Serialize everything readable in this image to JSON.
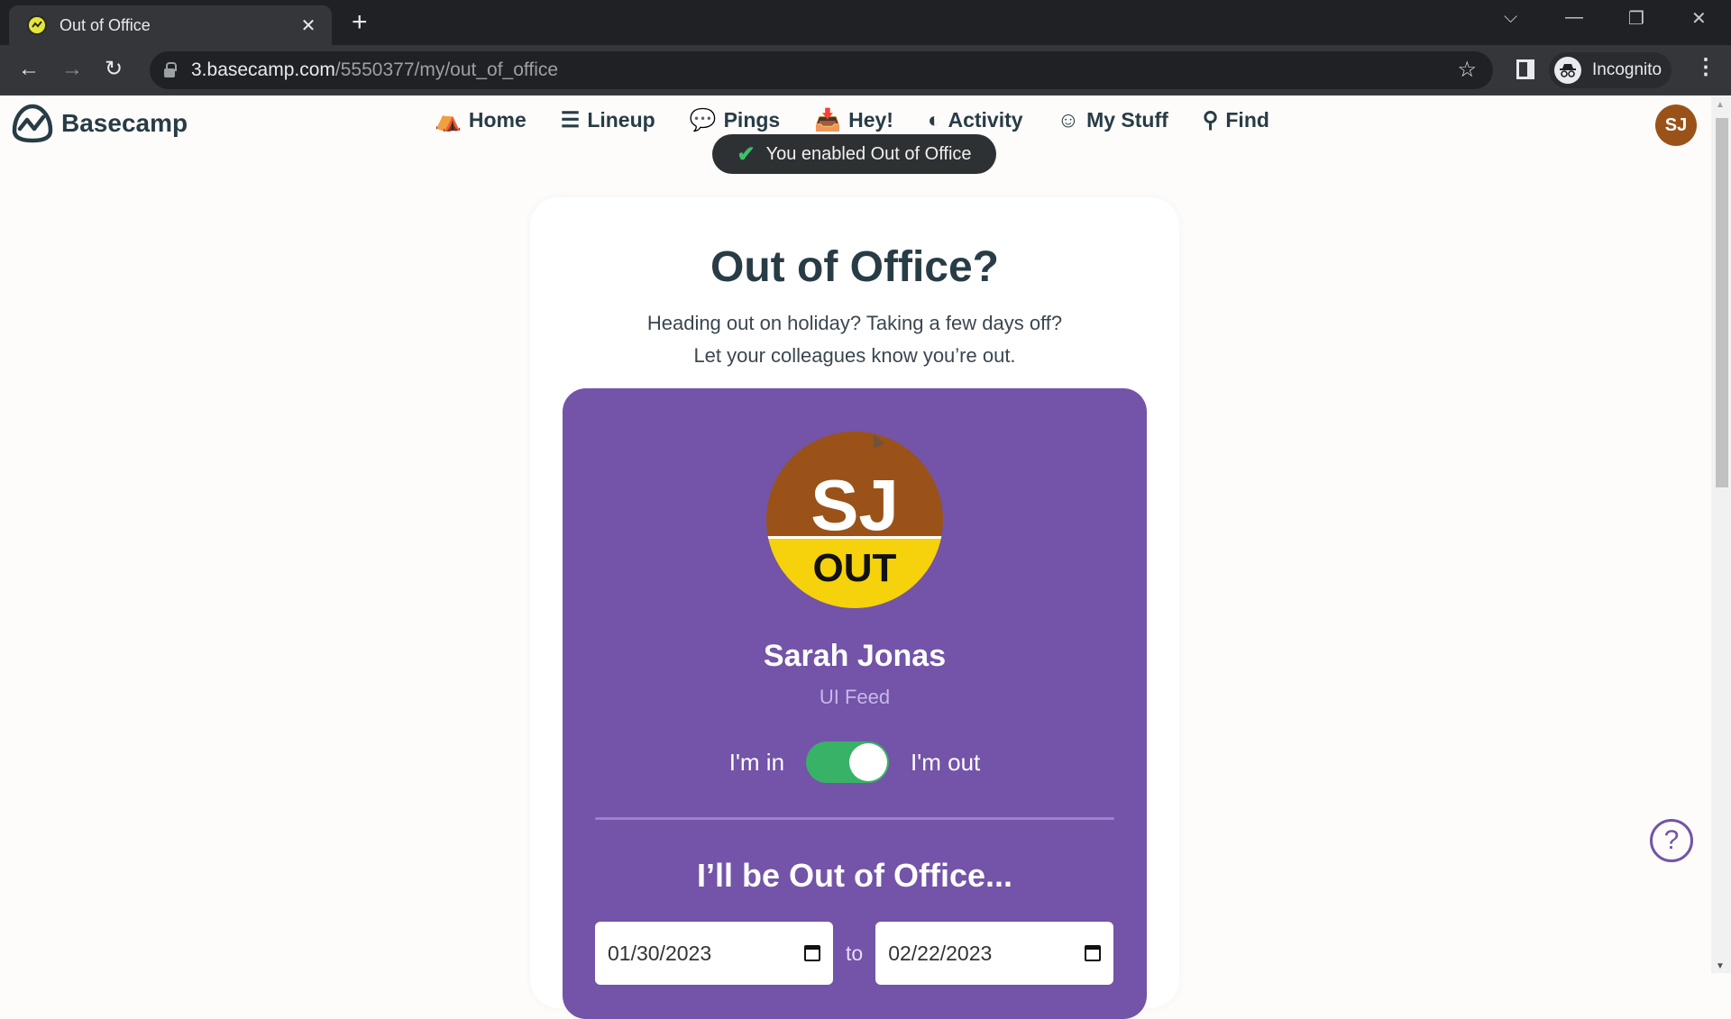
{
  "browser": {
    "tab_title": "Out of Office",
    "url_host": "3.basecamp.com",
    "url_path": "/5550377/my/out_of_office",
    "profile_label": "Incognito",
    "icons": {
      "back": "arrow-left-icon",
      "forward": "arrow-right-icon",
      "reload": "reload-icon",
      "bookmark": "star-icon",
      "side_panel": "side-panel-icon",
      "menu": "kebab-menu-icon"
    },
    "glyphs": {
      "close": "✕",
      "new_tab": "+",
      "back": "←",
      "forward": "→",
      "reload": "↻",
      "star": "☆",
      "tab_list": "⌵",
      "minimize": "—",
      "restore": "❐",
      "window_close": "✕",
      "kebab": "⋮",
      "incognito": "🕶"
    }
  },
  "app": {
    "logo_text": "Basecamp",
    "nav": [
      {
        "label": "Home",
        "icon": "⛺"
      },
      {
        "label": "Lineup",
        "icon": "☰"
      },
      {
        "label": "Pings",
        "icon": "💬"
      },
      {
        "label": "Hey!",
        "icon": "📥"
      },
      {
        "label": "Activity",
        "icon": "◐"
      },
      {
        "label": "My Stuff",
        "icon": "☺"
      },
      {
        "label": "Find",
        "icon": "⚲"
      }
    ],
    "user_initials": "SJ"
  },
  "toast": {
    "icon": "✔",
    "message": "You enabled Out of Office"
  },
  "page": {
    "title": "Out of Office?",
    "subtitle_line1": "Heading out on holiday? Taking a few days off?",
    "subtitle_line2": "Let your colleagues know you’re out.",
    "profile": {
      "initials": "SJ",
      "badge": "OUT",
      "name": "Sarah Jonas",
      "team": "UI Feed"
    },
    "toggle": {
      "left_label": "I'm in",
      "right_label": "I'm out",
      "state": "out"
    },
    "period_heading": "I’ll be Out of Office...",
    "start_date": "01/30/2023",
    "between_label": "to",
    "end_date": "02/22/2023"
  },
  "help_button": {
    "glyph": "?"
  },
  "colors": {
    "purple": "#7354a8",
    "toggle_on": "#38b266",
    "avatar_brown": "#9a5219",
    "out_yellow": "#f5d20c",
    "text_dark": "#283c46"
  }
}
